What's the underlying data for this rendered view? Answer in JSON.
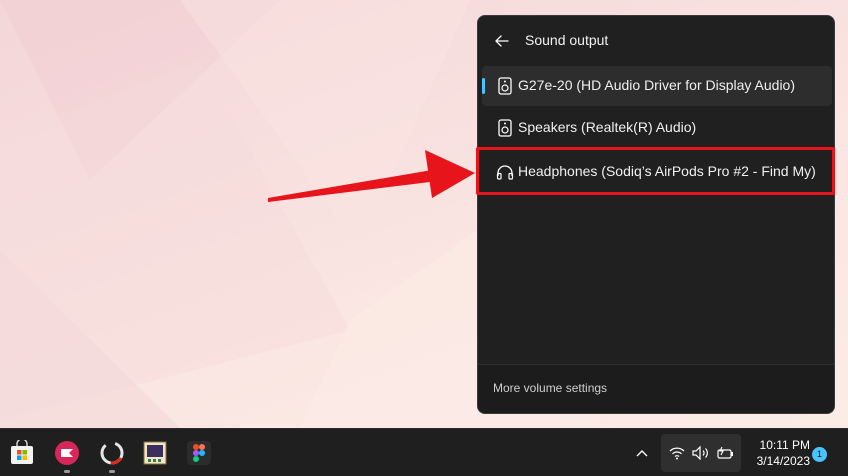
{
  "flyout": {
    "title": "Sound output",
    "back_icon": "arrow-left-icon",
    "devices": [
      {
        "label": "G27e-20 (HD Audio Driver for Display Audio)",
        "icon": "speaker-icon",
        "selected": true
      },
      {
        "label": "Speakers (Realtek(R) Audio)",
        "icon": "speaker-icon",
        "selected": false
      },
      {
        "label": "Headphones (Sodiq’s AirPods Pro #2 - Find My)",
        "icon": "headphones-icon",
        "selected": false
      }
    ],
    "footer_link": "More volume settings"
  },
  "annotation": {
    "color": "#e8141b",
    "highlighted_item": "Headphones (Sodiq’s AirPods Pro #2 - Find My)"
  },
  "taskbar": {
    "apps": [
      {
        "name": "microsoft-store-icon"
      },
      {
        "name": "pocket-casts-icon"
      },
      {
        "name": "recording-app-icon"
      },
      {
        "name": "image-viewer-icon"
      },
      {
        "name": "figma-icon"
      }
    ],
    "clock": {
      "time": "10:11 PM",
      "date": "3/14/2023"
    },
    "notification_count": "1"
  },
  "colors": {
    "accent": "#4cc2ff",
    "flyout_bg": "#202020",
    "taskbar_bg": "#1f1f1f"
  }
}
